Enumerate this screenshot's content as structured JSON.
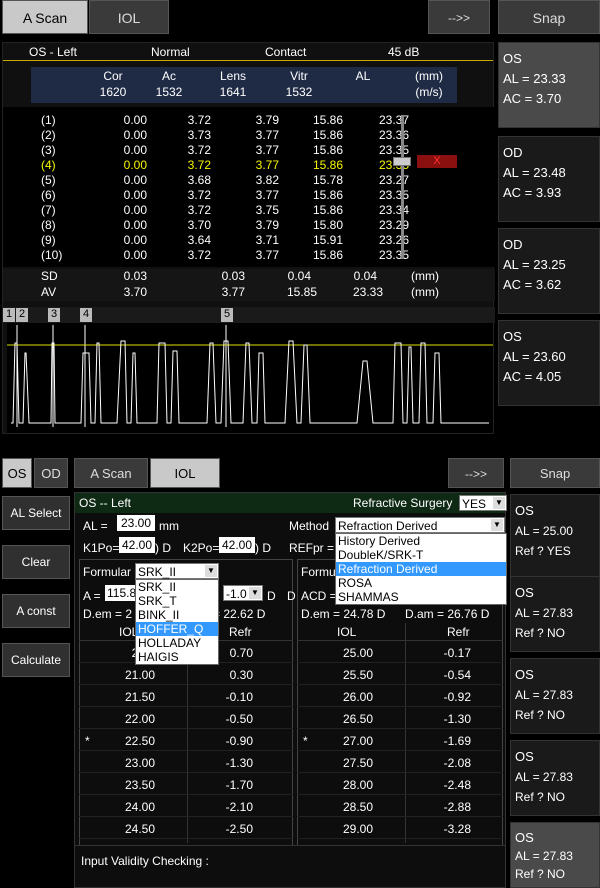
{
  "top": {
    "tabs": [
      {
        "label": "A Scan"
      },
      {
        "label": "IOL"
      }
    ],
    "next_label": "-->>",
    "snap_label": "Snap",
    "header": {
      "eye": "OS - Left",
      "mode": "Normal",
      "contact": "Contact",
      "gain": "45  dB"
    },
    "cols": [
      "Cor",
      "Ac",
      "Lens",
      "Vitr",
      "AL",
      "(mm)"
    ],
    "vel": [
      "1620",
      "1532",
      "1641",
      "1532",
      "",
      "(m/s)"
    ],
    "rows": [
      [
        "(1)",
        "0.00",
        "3.72",
        "3.79",
        "15.86",
        "23.37"
      ],
      [
        "(2)",
        "0.00",
        "3.73",
        "3.77",
        "15.86",
        "23.36"
      ],
      [
        "(3)",
        "0.00",
        "3.72",
        "3.77",
        "15.86",
        "23.35"
      ],
      [
        "(4)",
        "0.00",
        "3.72",
        "3.77",
        "15.86",
        "23.35"
      ],
      [
        "(5)",
        "0.00",
        "3.68",
        "3.82",
        "15.78",
        "23.27"
      ],
      [
        "(6)",
        "0.00",
        "3.72",
        "3.77",
        "15.86",
        "23.35"
      ],
      [
        "(7)",
        "0.00",
        "3.72",
        "3.75",
        "15.86",
        "23.34"
      ],
      [
        "(8)",
        "0.00",
        "3.70",
        "3.79",
        "15.80",
        "23.29"
      ],
      [
        "(9)",
        "0.00",
        "3.64",
        "3.71",
        "15.91",
        "23.26"
      ],
      [
        "(10)",
        "0.00",
        "3.72",
        "3.77",
        "15.86",
        "23.35"
      ]
    ],
    "x_label": "X",
    "sd": [
      "SD",
      "0.03",
      "",
      "0.03",
      "0.04",
      "0.04",
      "(mm)"
    ],
    "av": [
      "AV",
      "3.70",
      "",
      "3.77",
      "15.85",
      "23.33",
      "(mm)"
    ],
    "markers": [
      "1",
      "2",
      "3",
      "4",
      "5"
    ],
    "side": [
      {
        "eye": "OS",
        "al": "AL = 23.33",
        "ac": "AC = 3.70"
      },
      {
        "eye": "OD",
        "al": "AL = 23.48",
        "ac": "AC = 3.93"
      },
      {
        "eye": "OD",
        "al": "AL = 23.25",
        "ac": "AC = 3.62"
      },
      {
        "eye": "OS",
        "al": "AL = 23.60",
        "ac": "AC = 4.05"
      }
    ]
  },
  "bottom": {
    "os_label": "OS",
    "od_label": "OD",
    "tabs": [
      {
        "label": "A Scan"
      },
      {
        "label": "IOL"
      }
    ],
    "next_label": "-->>",
    "snap_label": "Snap",
    "left_buttons": [
      "AL Select",
      "Clear",
      "A const",
      "Calculate"
    ],
    "title": "OS -- Left",
    "refr_surgery_label": "Refractive Surgery",
    "refr_surgery_value": "YES",
    "al_label": "AL  =",
    "al_value": "23.00",
    "al_unit": "mm",
    "k1_label": "K1Po=",
    "k1_value": "42.00",
    "k1_unit": ") D",
    "k2_label": "K2Po=",
    "k2_value": "42.00",
    "k2_unit": ") D",
    "method_label": "Method",
    "method_value": "Refraction Derived",
    "refpr_label": "REFpr =",
    "method_options": [
      "History Derived",
      "DoubleK/SRK-T",
      "Refraction Derived",
      "ROSA",
      "SHAMMAS"
    ],
    "formular_label": "Formular",
    "formular_value": "SRK_II",
    "formular_options": [
      "SRK_II",
      "SRK_T",
      "BINK_II",
      "HOFFER_Q",
      "HOLLADAY",
      "HAIGIS"
    ],
    "formu_right": "Formu",
    "a_label": "A =",
    "a_value": "115.8",
    "a_tail_value": "-1.0",
    "a_tail_unit": "D",
    "acd_label": "ACD =",
    "dem_left": "D.em = 2",
    "dam_left": "= 22.62  D",
    "dem_right": "D.em = 24.78  D",
    "dam_right": "D.am = 26.76  D",
    "right_tail": "D",
    "iol_header": "IOL",
    "refr_header": "Refr",
    "left_table": [
      {
        "star": "",
        "iol": "20.5",
        "refr": "0.70"
      },
      {
        "star": "",
        "iol": "21.00",
        "refr": "0.30"
      },
      {
        "star": "",
        "iol": "21.50",
        "refr": "-0.10"
      },
      {
        "star": "",
        "iol": "22.00",
        "refr": "-0.50"
      },
      {
        "star": "*",
        "iol": "22.50",
        "refr": "-0.90"
      },
      {
        "star": "",
        "iol": "23.00",
        "refr": "-1.30"
      },
      {
        "star": "",
        "iol": "23.50",
        "refr": "-1.70"
      },
      {
        "star": "",
        "iol": "24.00",
        "refr": "-2.10"
      },
      {
        "star": "",
        "iol": "24.50",
        "refr": "-2.50"
      }
    ],
    "right_table": [
      {
        "star": "",
        "iol": "25.00",
        "refr": "-0.17"
      },
      {
        "star": "",
        "iol": "25.50",
        "refr": "-0.54"
      },
      {
        "star": "",
        "iol": "26.00",
        "refr": "-0.92"
      },
      {
        "star": "",
        "iol": "26.50",
        "refr": "-1.30"
      },
      {
        "star": "*",
        "iol": "27.00",
        "refr": "-1.69"
      },
      {
        "star": "",
        "iol": "27.50",
        "refr": "-2.08"
      },
      {
        "star": "",
        "iol": "28.00",
        "refr": "-2.48"
      },
      {
        "star": "",
        "iol": "28.50",
        "refr": "-2.88"
      },
      {
        "star": "",
        "iol": "29.00",
        "refr": "-3.28"
      }
    ],
    "validity": "Input Validity Checking :",
    "side": [
      {
        "eye": "OS",
        "al": "AL = 25.00",
        "ref": "Ref ? YES"
      },
      {
        "eye": "OS",
        "al": "AL = 27.83",
        "ref": "Ref ? NO"
      },
      {
        "eye": "OS",
        "al": "AL = 27.83",
        "ref": "Ref ? NO"
      },
      {
        "eye": "OS",
        "al": "AL = 27.83",
        "ref": "Ref ? NO"
      },
      {
        "eye": "OS",
        "al": "AL = 27.83",
        "ref": "Ref ? NO"
      }
    ]
  }
}
